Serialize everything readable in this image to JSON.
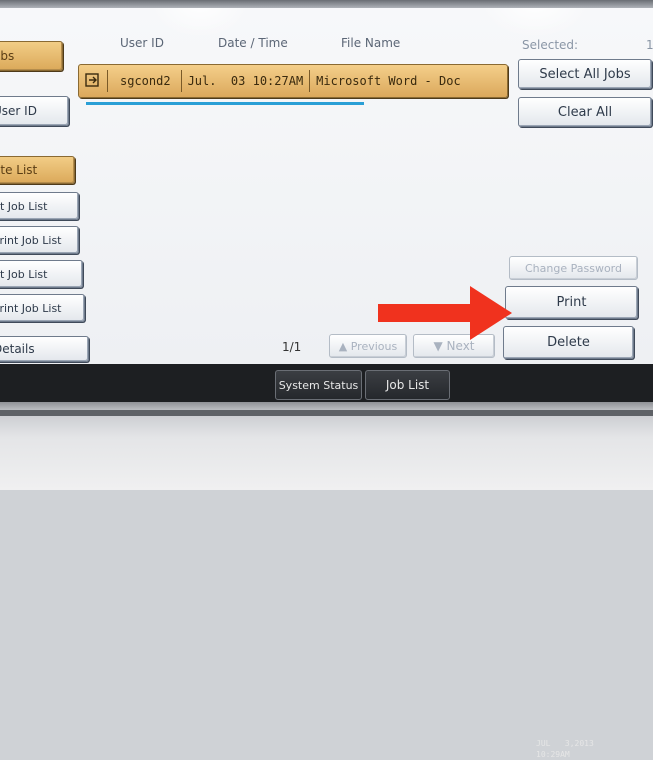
{
  "left_panel": {
    "items": [
      {
        "label": "obs",
        "selected": true
      },
      {
        "label": "User ID",
        "selected": false
      },
      {
        "label": "ete List",
        "selected": true
      },
      {
        "label": "nt Job List",
        "selected": false
      },
      {
        "label": "Print Job List",
        "selected": false
      },
      {
        "label": "nt Job List",
        "selected": false
      },
      {
        "label": "Print Job List",
        "selected": false
      },
      {
        "label": "Details",
        "selected": false
      }
    ]
  },
  "list": {
    "headers": {
      "user_id": "User ID",
      "date_time": "Date / Time",
      "file_name": "File Name"
    },
    "jobs": [
      {
        "user_id": "sgcond2",
        "date_time": "Jul.  03 10:27AM",
        "file_name": "Microsoft Word - Doc"
      }
    ],
    "page_indicator": "1/1",
    "previous_label": "▲ Previous",
    "next_label": "▼ Next"
  },
  "right_panel": {
    "selected_label": "Selected:",
    "selected_count": "1",
    "select_all_label": "Select All Jobs",
    "clear_all_label": "Clear All",
    "change_password_label": "Change Password",
    "print_label": "Print",
    "delete_label": "Delete"
  },
  "bottom_bar": {
    "system_status_label": "System Status",
    "job_list_label": "Job List",
    "date": "JUL   3,2013",
    "time": "10:29AM"
  },
  "colors": {
    "selected_fill": "#e6b86e",
    "annotation_arrow": "#f0321e",
    "highlight_underline": "#2a9fd6"
  }
}
